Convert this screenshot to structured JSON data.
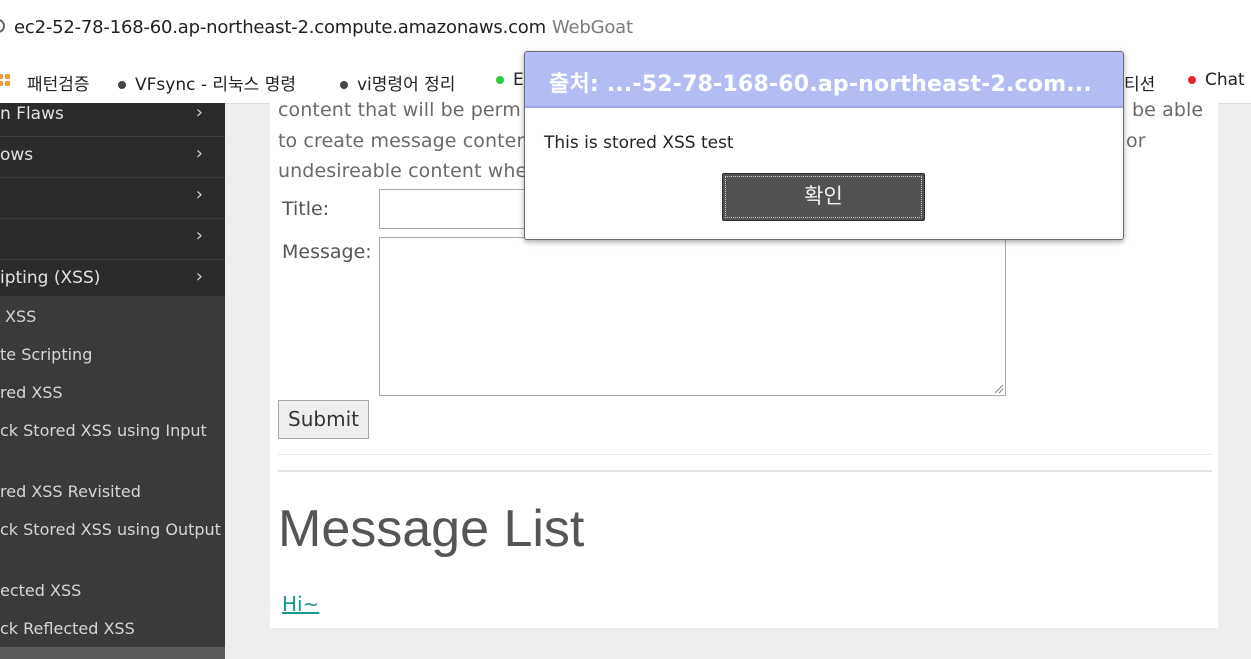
{
  "browser": {
    "url": "ec2-52-78-168-60.ap-northeast-2.compute.amazonaws.com",
    "page_title": "WebGoat",
    "bookmarks": [
      {
        "label": "패턴검증",
        "icon": "apps-grid-icon"
      },
      {
        "label": "VFsync - 리눅스 명령",
        "dot_color": "#444444"
      },
      {
        "label": "vi명령어 정리",
        "dot_color": "#444444"
      },
      {
        "label": "E",
        "dot_color": "#2ecc40"
      },
      {
        "label": "티션",
        "dot_color": null
      },
      {
        "label": "Chat",
        "dot_color": "#e8202c"
      }
    ]
  },
  "sidebar": {
    "categories": [
      {
        "label": "n Flaws"
      },
      {
        "label": "ows"
      },
      {
        "label": ""
      },
      {
        "label": ""
      },
      {
        "label": "ipting (XSS)"
      }
    ],
    "lessons": [
      "XSS",
      "te Scripting",
      "red XSS",
      "ck Stored XSS using Input",
      "red XSS Revisited",
      "ck Stored XSS using Output",
      "ected XSS",
      "ck Reflected XSS"
    ]
  },
  "main": {
    "paragraph": [
      "content that will be perm",
      "be able",
      "to create message conten",
      "or",
      "undesireable content whe"
    ],
    "form": {
      "title_label": "Title:",
      "message_label": "Message:",
      "submit_label": "Submit"
    },
    "message_list_heading": "Message List",
    "messages": [
      "Hi~"
    ]
  },
  "dialog": {
    "title": "출처: ...-52-78-168-60.ap-northeast-2.com...",
    "message": "This is stored XSS test",
    "ok_label": "확인",
    "header_color": "#b4bcf4"
  }
}
